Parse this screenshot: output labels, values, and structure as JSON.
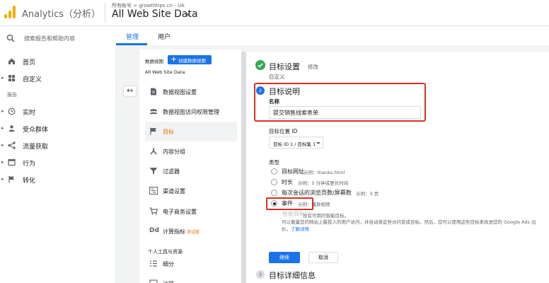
{
  "header": {
    "app_title": "Analytics（分析）",
    "account_path": "所有帐号 > growthtips.cn - UA",
    "view_name": "All Web Site Data"
  },
  "leftnav": {
    "search_placeholder": "搜索报告和帮助内容",
    "home": "首页",
    "customize": "自定义",
    "reports_section": "报告",
    "realtime": "实时",
    "audience": "受众群体",
    "acquisition": "流量获取",
    "behavior": "行为",
    "conversions": "转化"
  },
  "tabs": {
    "admin": "管理",
    "user": "用户"
  },
  "view_column": {
    "label": "数据视图",
    "create_button": "创建数据视图",
    "current_view": "All Web Site Data",
    "items": [
      {
        "label": "数据视图设置",
        "icon": "document-icon"
      },
      {
        "label": "数据视图访问权限管理",
        "icon": "people-icon"
      },
      {
        "label": "目标",
        "icon": "flag-icon"
      },
      {
        "label": "内容分组",
        "icon": "content-grouping-icon"
      },
      {
        "label": "过滤器",
        "icon": "filter-icon"
      },
      {
        "label": "渠道设置",
        "icon": "channel-icon"
      },
      {
        "label": "电子商务设置",
        "icon": "cart-icon"
      },
      {
        "label": "计算指标",
        "icon": "dd-icon"
      }
    ],
    "beta": "测试版",
    "personal_tools": "个人工具与资源",
    "segments": "细分",
    "partial_item": "注释"
  },
  "goal": {
    "step1_title": "目标设置",
    "step1_edit": "修改",
    "step1_value": "自定义",
    "step2_num": "2",
    "step2_title": "目标说明",
    "name_label": "名称",
    "name_value": "提交销售线索表单",
    "slot_label": "目标位置 ID",
    "slot_value": "目标 ID 1 / 目标集 1",
    "type_label": "类型",
    "types": [
      {
        "label": "目标网址",
        "example": "示例：thanks.html",
        "checked": false
      },
      {
        "label": "时长",
        "example": "示例：5 分钟或更长时间",
        "checked": false
      },
      {
        "label": "每次会话的浏览页数/屏幕数",
        "example": "示例：3 页",
        "checked": false
      },
      {
        "label": "事件",
        "example": "示例：播放视频",
        "checked": true
      }
    ],
    "smart_label": "智能目标",
    "smart_note": "没有可用的智能目标。",
    "smart_desc": "可以衡量您的网站上最投入的用户访问，并自动将这些访问变成目标。然后，您可以使用这些目标来改进您的 Google Ads 出价。",
    "learn_more": "了解详情",
    "continue": "继续",
    "cancel": "取消",
    "step3_num": "3",
    "step3_title": "目标详细信息"
  },
  "colors": {
    "accent": "#1a73e8",
    "highlight_box": "#d93025",
    "active_item": "#e37400",
    "logo": "#f9ab00",
    "success": "#34a853"
  }
}
